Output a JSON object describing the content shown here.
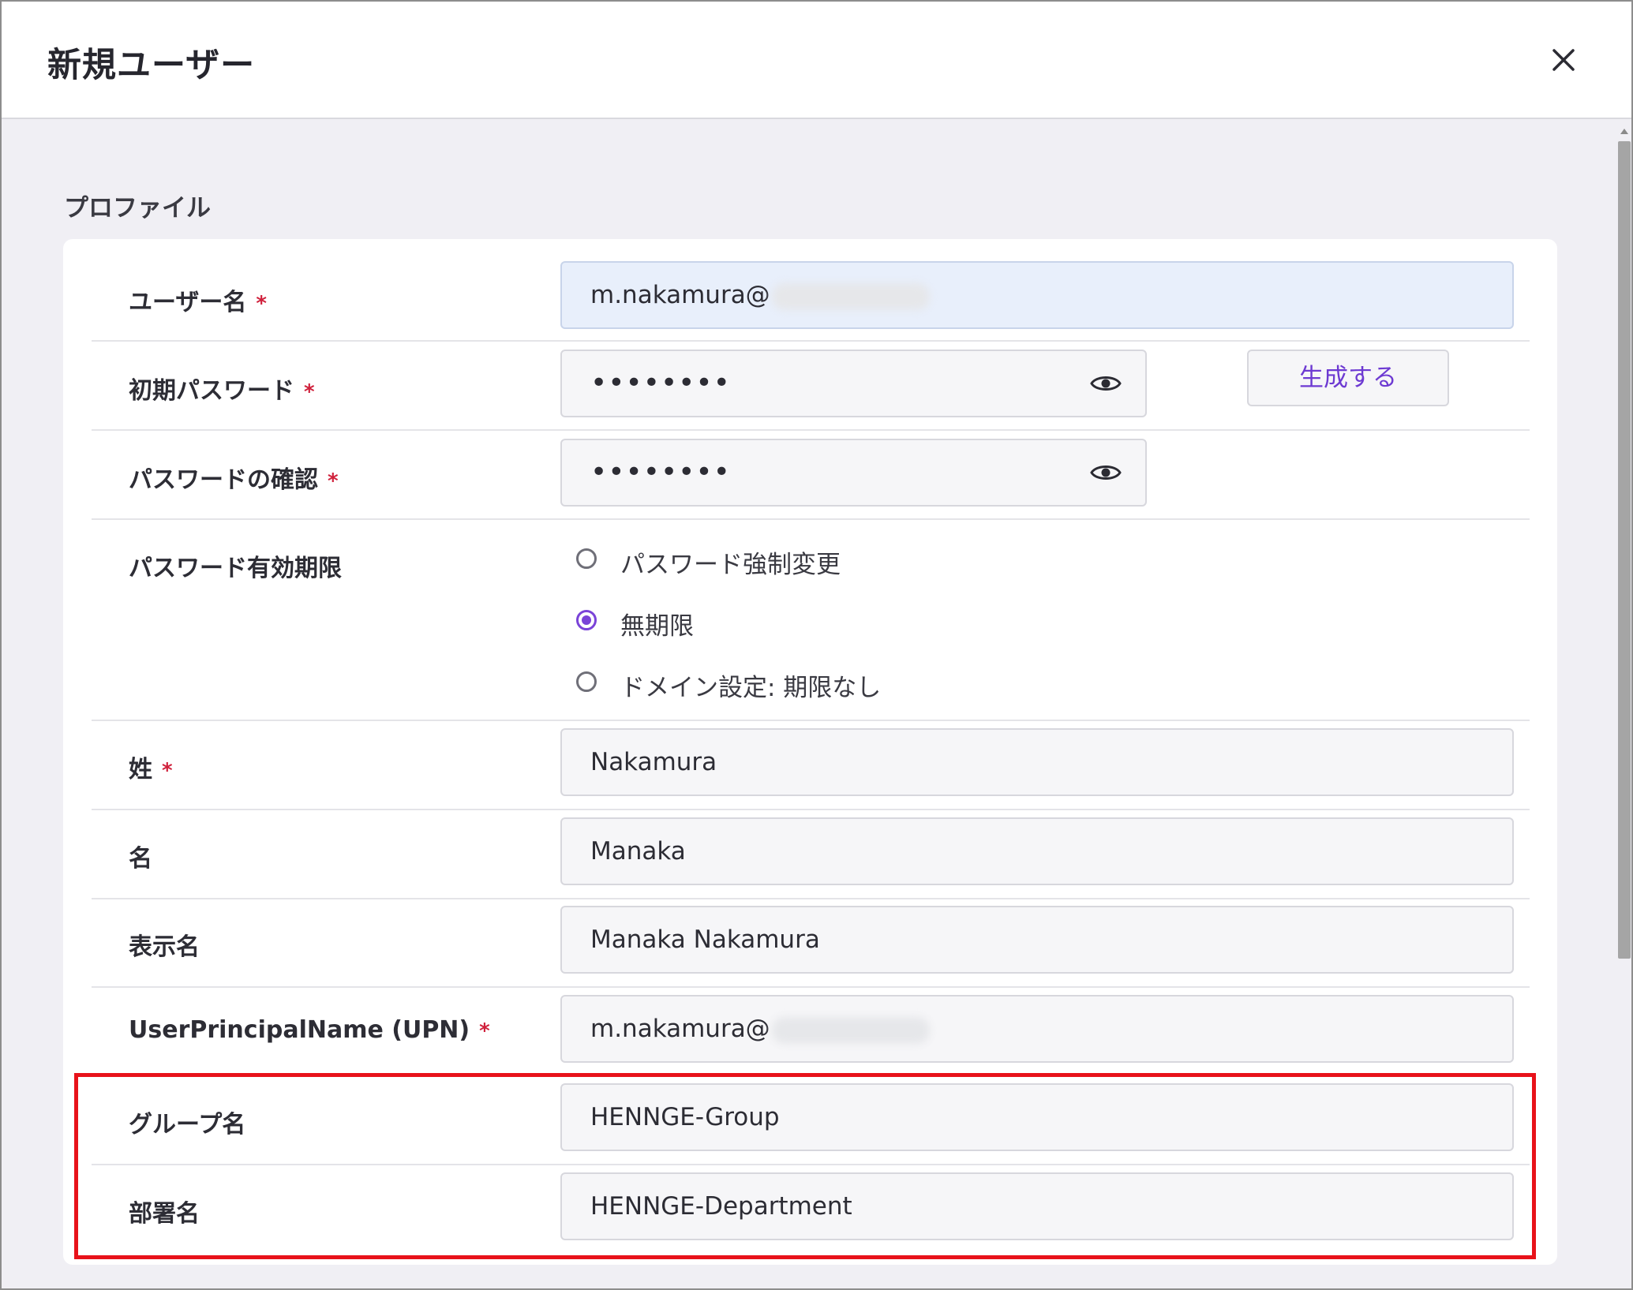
{
  "dialog": {
    "title": "新規ユーザー",
    "close_icon": "close-icon"
  },
  "profile": {
    "section_title": "プロファイル",
    "required_mark": "*",
    "username": {
      "label": "ユーザー名",
      "value": "m.nakamura@"
    },
    "initial_password": {
      "label": "初期パスワード",
      "value": "••••••••",
      "generate_button": "生成する"
    },
    "password_confirm": {
      "label": "パスワードの確認",
      "value": "••••••••"
    },
    "password_expiry": {
      "label": "パスワード有効期限",
      "options": [
        "パスワード強制変更",
        "無期限",
        "ドメイン設定: 期限なし"
      ],
      "selected": "無期限"
    },
    "last_name": {
      "label": "姓",
      "value": "Nakamura"
    },
    "first_name": {
      "label": "名",
      "value": "Manaka"
    },
    "display_name": {
      "label": "表示名",
      "value": "Manaka Nakamura"
    },
    "upn": {
      "label": "UserPrincipalName (UPN)",
      "value": "m.nakamura@"
    },
    "group_name": {
      "label": "グループ名",
      "value": "HENNGE-Group"
    },
    "department_name": {
      "label": "部署名",
      "value": "HENNGE-Department"
    }
  },
  "colors": {
    "accent": "#7a43d8",
    "required": "#d0213c",
    "highlight_border": "#e8121a",
    "focused_input": "#e8effb"
  }
}
